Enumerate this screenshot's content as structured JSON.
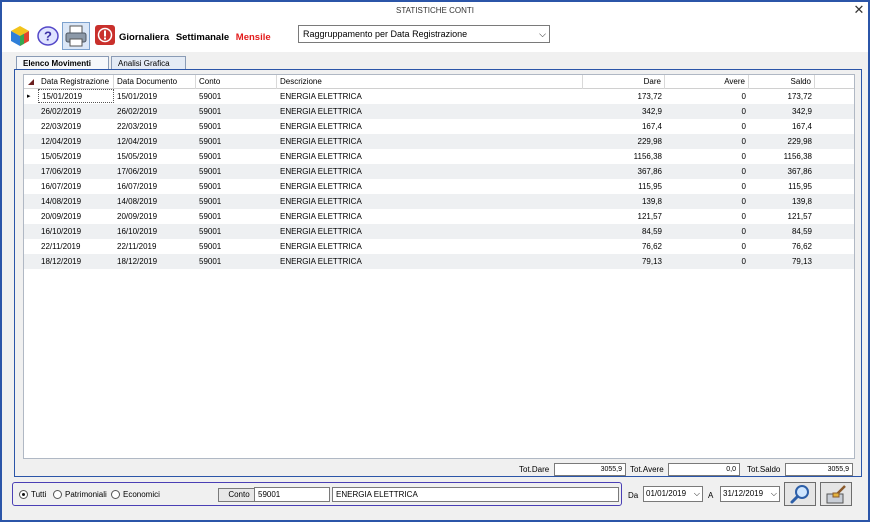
{
  "window": {
    "title": "STATISTICHE CONTI"
  },
  "toolbar": {
    "icons": [
      "cube-icon",
      "help-icon",
      "print-icon",
      "stop-icon"
    ],
    "periods": [
      {
        "label": "Giornaliera",
        "active": false
      },
      {
        "label": "Settimanale",
        "active": false
      },
      {
        "label": "Mensile",
        "active": true
      }
    ],
    "grouping": "Raggruppamento per Data Registrazione"
  },
  "tabs": [
    {
      "label": "Elenco Movimenti",
      "active": true
    },
    {
      "label": "Analisi Grafica",
      "active": false
    }
  ],
  "grid": {
    "columns": [
      "Data Registrazione",
      "Data Documento",
      "Conto",
      "Descrizione",
      "Dare",
      "Avere",
      "Saldo"
    ],
    "rows": [
      [
        "15/01/2019",
        "15/01/2019",
        "59001",
        "ENERGIA ELETTRICA",
        "173,72",
        "0",
        "173,72"
      ],
      [
        "26/02/2019",
        "26/02/2019",
        "59001",
        "ENERGIA ELETTRICA",
        "342,9",
        "0",
        "342,9"
      ],
      [
        "22/03/2019",
        "22/03/2019",
        "59001",
        "ENERGIA ELETTRICA",
        "167,4",
        "0",
        "167,4"
      ],
      [
        "12/04/2019",
        "12/04/2019",
        "59001",
        "ENERGIA ELETTRICA",
        "229,98",
        "0",
        "229,98"
      ],
      [
        "15/05/2019",
        "15/05/2019",
        "59001",
        "ENERGIA ELETTRICA",
        "1156,38",
        "0",
        "1156,38"
      ],
      [
        "17/06/2019",
        "17/06/2019",
        "59001",
        "ENERGIA ELETTRICA",
        "367,86",
        "0",
        "367,86"
      ],
      [
        "16/07/2019",
        "16/07/2019",
        "59001",
        "ENERGIA ELETTRICA",
        "115,95",
        "0",
        "115,95"
      ],
      [
        "14/08/2019",
        "14/08/2019",
        "59001",
        "ENERGIA ELETTRICA",
        "139,8",
        "0",
        "139,8"
      ],
      [
        "20/09/2019",
        "20/09/2019",
        "59001",
        "ENERGIA ELETTRICA",
        "121,57",
        "0",
        "121,57"
      ],
      [
        "16/10/2019",
        "16/10/2019",
        "59001",
        "ENERGIA ELETTRICA",
        "84,59",
        "0",
        "84,59"
      ],
      [
        "22/11/2019",
        "22/11/2019",
        "59001",
        "ENERGIA ELETTRICA",
        "76,62",
        "0",
        "76,62"
      ],
      [
        "18/12/2019",
        "18/12/2019",
        "59001",
        "ENERGIA ELETTRICA",
        "79,13",
        "0",
        "79,13"
      ]
    ]
  },
  "totals": {
    "dare_label": "Tot.Dare",
    "dare_value": "3055,9",
    "avere_label": "Tot.Avere",
    "avere_value": "0,0",
    "saldo_label": "Tot.Saldo",
    "saldo_value": "3055,9"
  },
  "filter": {
    "radios": [
      {
        "label": "Tutti",
        "checked": true
      },
      {
        "label": "Patrimoniali",
        "checked": false
      },
      {
        "label": "Economici",
        "checked": false
      }
    ],
    "conto_label": "Conto",
    "conto_code": "59001",
    "conto_desc": "ENERGIA ELETTRICA"
  },
  "dates": {
    "from_label": "Da",
    "from_value": "01/01/2019",
    "to_label": "A",
    "to_value": "31/12/2019"
  },
  "actions": [
    "search-icon",
    "clear-icon"
  ]
}
